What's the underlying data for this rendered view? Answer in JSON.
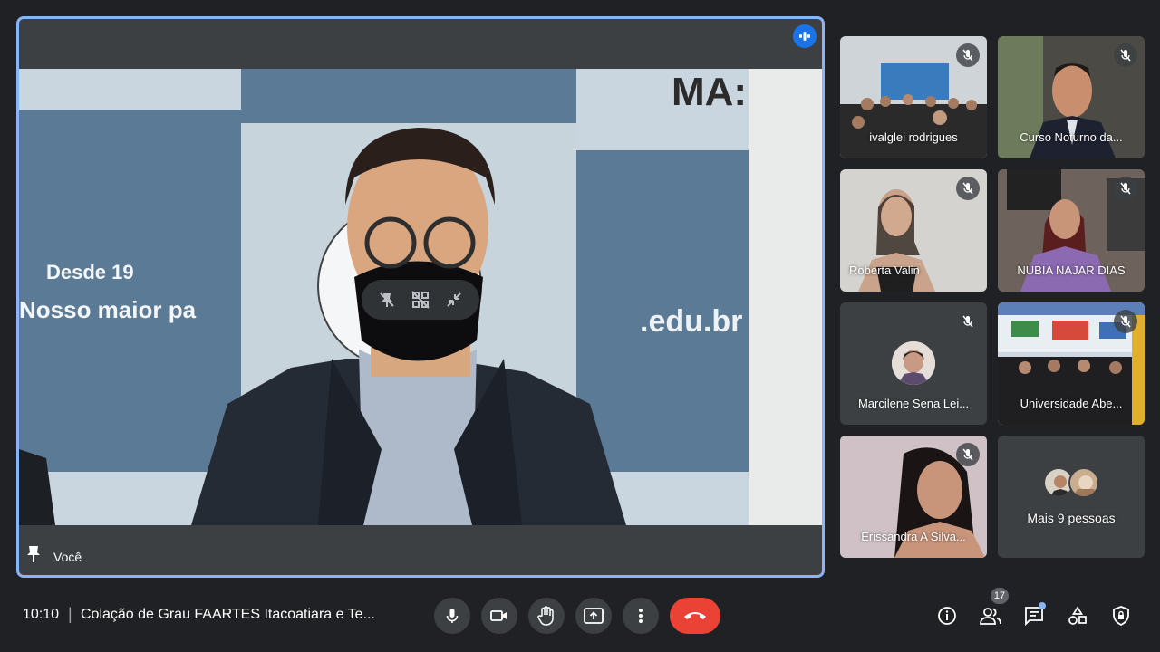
{
  "main": {
    "self_label": "Você"
  },
  "participants": [
    {
      "name": "ivalglei rodrigues",
      "muted": true
    },
    {
      "name": "Curso Noturno da...",
      "muted": true
    },
    {
      "name": "Roberta Valin",
      "muted": true
    },
    {
      "name": "NUBIA NAJAR DIAS",
      "muted": true
    },
    {
      "name": "Marcilene Sena Lei...",
      "muted": true
    },
    {
      "name": "Universidade Abe...",
      "muted": true
    },
    {
      "name": "Erissandra A Silva...",
      "muted": true
    }
  ],
  "more": {
    "label": "Mais 9 pessoas"
  },
  "bottom": {
    "time": "10:10",
    "separator": "|",
    "meeting_title": "Colação de Grau FAARTES Itacoatiara e Te...",
    "people_count": "17"
  },
  "colors": {
    "accent": "#8ab4f8",
    "end_call": "#ea4335",
    "speaking": "#1a73e8"
  }
}
